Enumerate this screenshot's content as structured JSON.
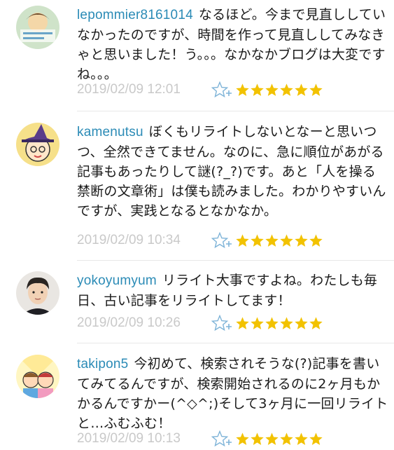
{
  "colors": {
    "username": "#2b8bb6",
    "date": "#c9c9c9",
    "star": "#f2c200",
    "add_star": "#7fb4d8"
  },
  "comments": [
    {
      "username": "lepommier8161014",
      "text": "なるほど。今まで見直ししていなかったのですが、時間を作って見直ししてみなきゃと思いました！う。。。なかなかブログは大変ですね。。。",
      "date": "2019/02/09 12:01",
      "stars": 6,
      "avatar_icon": "illustrated-avatar-icon"
    },
    {
      "username": "kamenutsu",
      "text": "ぼくもリライトしないとなーと思いつつ、全然できてません。なのに、急に順位があがる記事もあったりして謎(?_?)です。あと「人を操る禁断の文章術」は僕も読みました。わかりやすいんですが、実践となるとなかなか。",
      "date": "2019/02/09 10:34",
      "stars": 6,
      "avatar_icon": "witch-hat-avatar-icon"
    },
    {
      "username": "yokoyumyum",
      "text": "リライト大事ですよね。わたしも毎日、古い記事をリライトしてます！",
      "date": "2019/02/09 10:26",
      "stars": 6,
      "avatar_icon": "person-photo-avatar-icon"
    },
    {
      "username": "takipon5",
      "text": "今初めて、検索されそうな(?)記事を書いてみてるんですが、検索開始されるのに2ヶ月もかかるんですかー(^◇^;)そして3ヶ月に一回リライトと…ふむふむ！",
      "date": "2019/02/09 10:13",
      "stars": 6,
      "avatar_icon": "cartoon-kids-avatar-icon"
    }
  ]
}
